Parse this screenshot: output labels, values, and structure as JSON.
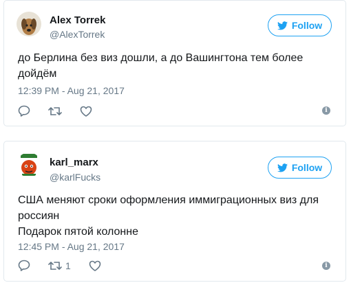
{
  "tweets": [
    {
      "name": "Alex Torrek",
      "handle": "@AlexTorrek",
      "follow_label": "Follow",
      "text": "до Берлина без виз дошли, а до Вашингтона тем более дойдём",
      "date": "12:39 PM - Aug 21, 2017",
      "retweet_count": "",
      "colors": {
        "accent": "#1da1f2",
        "muted": "#657786"
      }
    },
    {
      "name": "karl_marx",
      "handle": "@karlFucks",
      "follow_label": "Follow",
      "text_line1": "США меняют сроки оформления иммиграционных виз для россиян",
      "text_line2": "Подарок пятой колонне",
      "date": "12:45 PM - Aug 21, 2017",
      "retweet_count": "1"
    }
  ],
  "icons": [
    "reply-icon",
    "retweet-icon",
    "like-icon",
    "info-icon",
    "twitter-bird-icon"
  ]
}
